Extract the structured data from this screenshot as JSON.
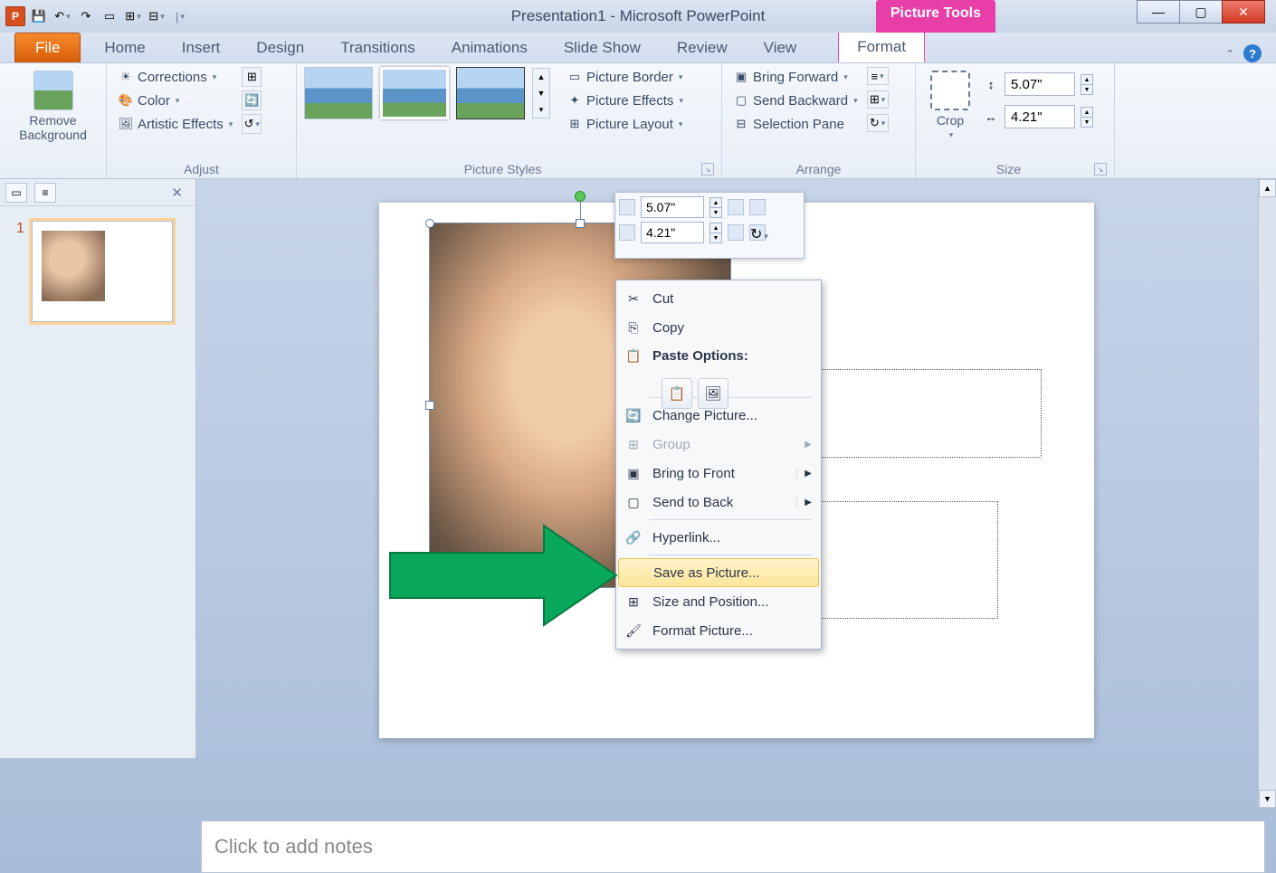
{
  "titlebar": {
    "title": "Presentation1 - Microsoft PowerPoint",
    "picture_tools": "Picture Tools"
  },
  "tabs": {
    "file": "File",
    "home": "Home",
    "insert": "Insert",
    "design": "Design",
    "transitions": "Transitions",
    "animations": "Animations",
    "slideshow": "Slide Show",
    "review": "Review",
    "view": "View",
    "format": "Format"
  },
  "ribbon": {
    "remove_bg": "Remove\nBackground",
    "corrections": "Corrections",
    "color": "Color",
    "artistic": "Artistic Effects",
    "adjust_label": "Adjust",
    "styles_label": "Picture Styles",
    "border": "Picture Border",
    "effects": "Picture Effects",
    "layout": "Picture Layout",
    "bring_fwd": "Bring Forward",
    "send_back": "Send Backward",
    "sel_pane": "Selection Pane",
    "arrange_label": "Arrange",
    "crop": "Crop",
    "size_label": "Size",
    "height": "5.07\"",
    "width": "4.21\""
  },
  "mini_toolbar": {
    "h": "5.07\"",
    "w": "4.21\""
  },
  "context_menu": {
    "cut": "Cut",
    "copy": "Copy",
    "paste_options": "Paste Options:",
    "change_picture": "Change Picture...",
    "group": "Group",
    "bring_front": "Bring to Front",
    "send_back": "Send to Back",
    "hyperlink": "Hyperlink...",
    "save_as_picture": "Save as Picture...",
    "size_position": "Size and Position...",
    "format_picture": "Format Picture..."
  },
  "slide_panel": {
    "slide_number": "1"
  },
  "notes": {
    "placeholder": "Click to add notes"
  }
}
